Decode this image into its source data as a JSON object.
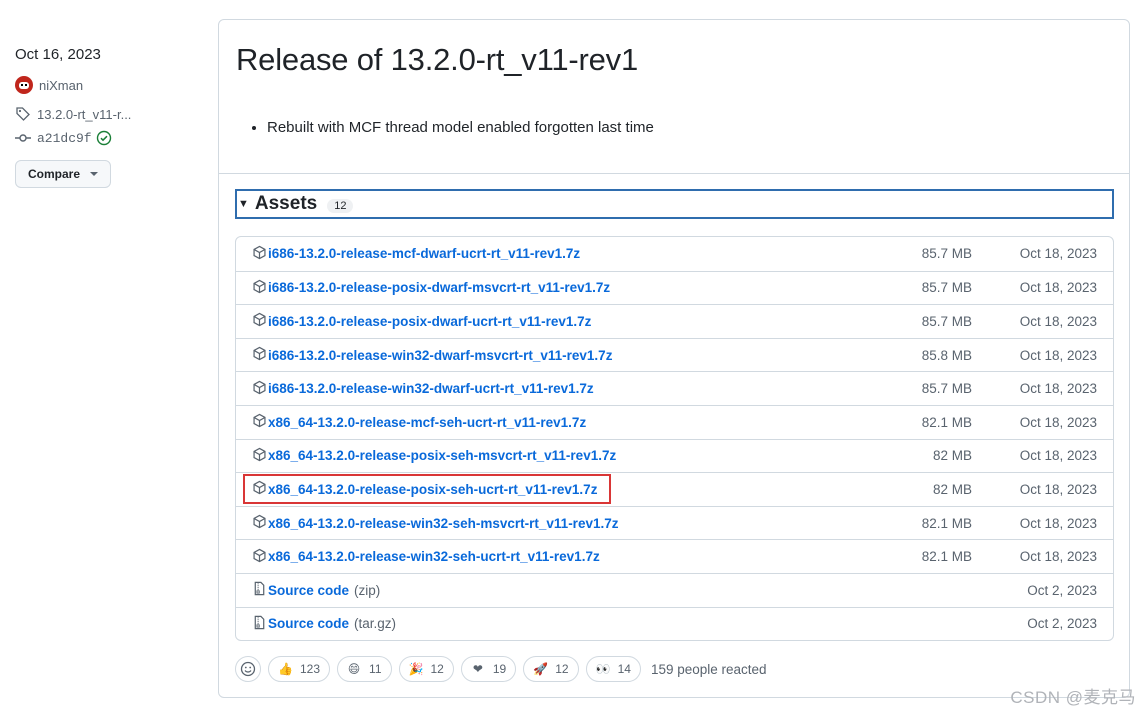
{
  "meta": {
    "date": "Oct 16, 2023",
    "author": "niXman",
    "tag": "13.2.0-rt_v11-r...",
    "commit": "a21dc9f",
    "compare_label": "Compare"
  },
  "release": {
    "title": "Release of 13.2.0-rt_v11-rev1",
    "notes": [
      "Rebuilt with MCF thread model enabled forgotten last time"
    ]
  },
  "assets": {
    "label": "Assets",
    "count": "12",
    "items": [
      {
        "name": "i686-13.2.0-release-mcf-dwarf-ucrt-rt_v11-rev1.7z",
        "suffix": "",
        "size": "85.7 MB",
        "date": "Oct 18, 2023",
        "icon": "package-icon"
      },
      {
        "name": "i686-13.2.0-release-posix-dwarf-msvcrt-rt_v11-rev1.7z",
        "suffix": "",
        "size": "85.7 MB",
        "date": "Oct 18, 2023",
        "icon": "package-icon"
      },
      {
        "name": "i686-13.2.0-release-posix-dwarf-ucrt-rt_v11-rev1.7z",
        "suffix": "",
        "size": "85.7 MB",
        "date": "Oct 18, 2023",
        "icon": "package-icon"
      },
      {
        "name": "i686-13.2.0-release-win32-dwarf-msvcrt-rt_v11-rev1.7z",
        "suffix": "",
        "size": "85.8 MB",
        "date": "Oct 18, 2023",
        "icon": "package-icon"
      },
      {
        "name": "i686-13.2.0-release-win32-dwarf-ucrt-rt_v11-rev1.7z",
        "suffix": "",
        "size": "85.7 MB",
        "date": "Oct 18, 2023",
        "icon": "package-icon"
      },
      {
        "name": "x86_64-13.2.0-release-mcf-seh-ucrt-rt_v11-rev1.7z",
        "suffix": "",
        "size": "82.1 MB",
        "date": "Oct 18, 2023",
        "icon": "package-icon"
      },
      {
        "name": "x86_64-13.2.0-release-posix-seh-msvcrt-rt_v11-rev1.7z",
        "suffix": "",
        "size": "82 MB",
        "date": "Oct 18, 2023",
        "icon": "package-icon"
      },
      {
        "name": "x86_64-13.2.0-release-posix-seh-ucrt-rt_v11-rev1.7z",
        "suffix": "",
        "size": "82 MB",
        "date": "Oct 18, 2023",
        "icon": "package-icon",
        "highlighted": true
      },
      {
        "name": "x86_64-13.2.0-release-win32-seh-msvcrt-rt_v11-rev1.7z",
        "suffix": "",
        "size": "82.1 MB",
        "date": "Oct 18, 2023",
        "icon": "package-icon"
      },
      {
        "name": "x86_64-13.2.0-release-win32-seh-ucrt-rt_v11-rev1.7z",
        "suffix": "",
        "size": "82.1 MB",
        "date": "Oct 18, 2023",
        "icon": "package-icon"
      },
      {
        "name": "Source code",
        "suffix": "(zip)",
        "size": "",
        "date": "Oct 2, 2023",
        "icon": "file-zip-icon"
      },
      {
        "name": "Source code",
        "suffix": "(tar.gz)",
        "size": "",
        "date": "Oct 2, 2023",
        "icon": "file-zip-icon"
      }
    ]
  },
  "reactions": {
    "items": [
      {
        "emoji": "👍",
        "icon": "thumbs-up-icon",
        "count": "123"
      },
      {
        "emoji": "😄",
        "icon": "laugh-icon",
        "count": "11"
      },
      {
        "emoji": "🎉",
        "icon": "hooray-icon",
        "count": "12"
      },
      {
        "emoji": "❤",
        "icon": "heart-icon",
        "count": "19"
      },
      {
        "emoji": "🚀",
        "icon": "rocket-icon",
        "count": "12"
      },
      {
        "emoji": "👀",
        "icon": "eyes-icon",
        "count": "14"
      }
    ],
    "summary": "159 people reacted"
  },
  "watermark": "CSDN @麦克马",
  "colors": {
    "link": "#0969da",
    "border": "#d1d9e0",
    "focus": "#2f6dae",
    "highlight": "#d93636"
  }
}
